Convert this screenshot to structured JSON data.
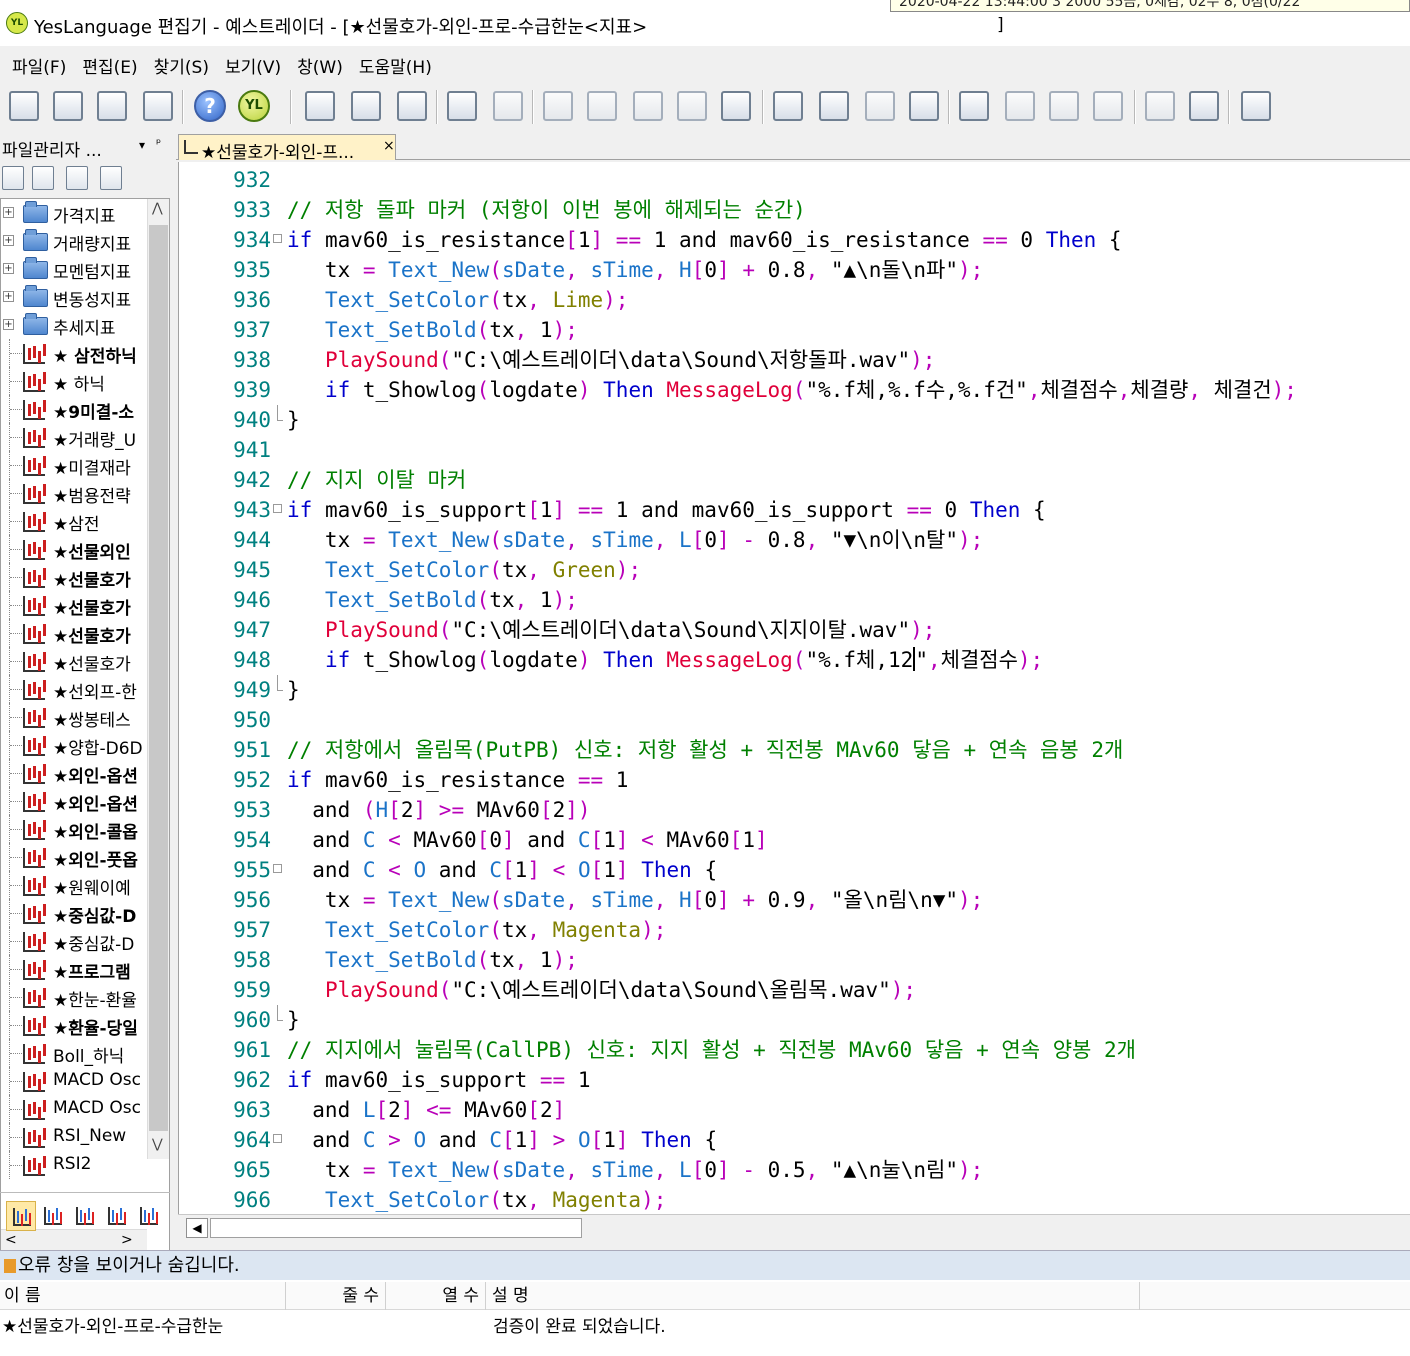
{
  "window": {
    "title": "YesLanguage 편집기 - 예스트레이더 - [★선물호가-외인-프로-수급한눈<지표>",
    "title_bracket": "]",
    "tooltip_fragment": "2020-04-22 13:44:00       3 2000  55금,  0체감,  02수 8,  0점(0/22"
  },
  "menu": {
    "items": [
      "파일(F)",
      "편집(E)",
      "찾기(S)",
      "보기(V)",
      "창(W)",
      "도움말(H)"
    ]
  },
  "toolbar": {
    "help_glyph": "?",
    "yl_glyph": "YL",
    "buttons": [
      "new-file",
      "open-file",
      "save-file",
      "print",
      "help",
      "yeslanguage",
      "verify",
      "compile",
      "build",
      "table",
      "table-alt",
      "cut",
      "copy",
      "paste",
      "grid",
      "grid-alt",
      "find",
      "find-next",
      "replace",
      "spell-check",
      "book-open",
      "book-prev",
      "book-next",
      "book-close",
      "comment",
      "uncomment",
      "settings"
    ]
  },
  "left_panel": {
    "title": "파일관리자 ...",
    "dropdown_glyph": "▾",
    "pin_glyph": "ᵖ",
    "folders": [
      "가격지표",
      "거래량지표",
      "모멘텀지표",
      "변동성지표",
      "추세지표"
    ],
    "files": [
      {
        "label": "★ 삼전하닉",
        "bold": true
      },
      {
        "label": "★ 하닉",
        "bold": false
      },
      {
        "label": "★9미결-소",
        "bold": true
      },
      {
        "label": "★거래량_U",
        "bold": false
      },
      {
        "label": "★미결재라",
        "bold": false
      },
      {
        "label": "★범용전략",
        "bold": false
      },
      {
        "label": "★삼전",
        "bold": false
      },
      {
        "label": "★선물외인",
        "bold": true
      },
      {
        "label": "★선물호가",
        "bold": true
      },
      {
        "label": "★선물호가",
        "bold": true
      },
      {
        "label": "★선물호가",
        "bold": true
      },
      {
        "label": "★선물호가",
        "bold": false
      },
      {
        "label": "★선외프-한",
        "bold": false
      },
      {
        "label": "★쌍봉테스",
        "bold": false
      },
      {
        "label": "★양합-D6D",
        "bold": false
      },
      {
        "label": "★외인-옵션",
        "bold": true
      },
      {
        "label": "★외인-옵션",
        "bold": true
      },
      {
        "label": "★외인-콜옵",
        "bold": true
      },
      {
        "label": "★외인-풋옵",
        "bold": true
      },
      {
        "label": "★원웨이예",
        "bold": false
      },
      {
        "label": "★중심값-D",
        "bold": true
      },
      {
        "label": "★중심값-D",
        "bold": false
      },
      {
        "label": "★프로그램",
        "bold": true
      },
      {
        "label": "★한눈-환율",
        "bold": false
      },
      {
        "label": "★환율-당일",
        "bold": true
      },
      {
        "label": "Boll_하닉",
        "bold": false
      },
      {
        "label": "MACD Osc",
        "bold": false
      },
      {
        "label": "MACD Osc",
        "bold": false
      },
      {
        "label": "RSI_New",
        "bold": false
      },
      {
        "label": "RSI2",
        "bold": false
      }
    ],
    "scroll_up": "⋀",
    "scroll_down": "⋁",
    "scroll_left": "<",
    "scroll_right": ">"
  },
  "editor": {
    "tab_label": "★선물호가-외인-프...",
    "tab_close": "×",
    "scroll_left": "◀"
  },
  "output": {
    "title": "오류 창을 보이거나 숨깁니다.",
    "columns": [
      "이 름",
      "줄 수",
      "열 수",
      "설 명"
    ],
    "rows": [
      {
        "name": "★선물호가-외인-프로-수급한눈",
        "line": "",
        "col": "",
        "desc": "검증이 완료 되었습니다."
      }
    ]
  },
  "code_lines": [
    {
      "n": "932",
      "fold": "",
      "html": ""
    },
    {
      "n": "933",
      "fold": "",
      "html": "<span class='cmt'>// 저항 돌파 마커 (저항이 이번 봉에 해제되는 순간)</span>"
    },
    {
      "n": "934",
      "fold": "box",
      "html": "<span class='kw'>if</span> mav60_is_resistance<span class='op'>[</span>1<span class='op'>]</span> <span class='op'>==</span> 1 and mav60_is_resistance <span class='op'>==</span> 0 <span class='kw'>Then</span> {"
    },
    {
      "n": "935",
      "fold": "",
      "html": "   tx <span class='op'>=</span> <span class='fn-cyan'>Text_New</span><span class='op'>(</span><span class='fn-cyan'>sDate</span><span class='op'>,</span> <span class='fn-cyan'>sTime</span><span class='op'>,</span> <span class='fn-cyan'>H</span><span class='op'>[</span>0<span class='op'>]</span> <span class='op'>+</span> 0.8<span class='op'>,</span> \"▲\\n돌\\n파\"<span class='op'>);</span>"
    },
    {
      "n": "936",
      "fold": "",
      "html": "   <span class='fn-cyan'>Text_SetColor</span><span class='op'>(</span>tx<span class='op'>,</span> <span class='olive'>Lime</span><span class='op'>);</span>"
    },
    {
      "n": "937",
      "fold": "",
      "html": "   <span class='fn-cyan'>Text_SetBold</span><span class='op'>(</span>tx<span class='op'>,</span> 1<span class='op'>);</span>"
    },
    {
      "n": "938",
      "fold": "",
      "html": "   <span class='fn-red'>PlaySound</span><span class='op'>(</span>\"C:\\예스트레이더\\data\\Sound\\저항돌파.wav\"<span class='op'>);</span>"
    },
    {
      "n": "939",
      "fold": "",
      "html": "   <span class='kw'>if</span> t_Showlog<span class='op'>(</span>logdate<span class='op'>)</span> <span class='kw'>Then</span> <span class='fn-red'>MessageLog</span><span class='op'>(</span>\"%.f체,%.f수,%.f건\"<span class='op'>,</span>체결점수<span class='op'>,</span>체결량<span class='op'>,</span> 체결건<span class='op'>);</span>"
    },
    {
      "n": "940",
      "fold": "end",
      "html": "}"
    },
    {
      "n": "941",
      "fold": "",
      "html": ""
    },
    {
      "n": "942",
      "fold": "",
      "html": "<span class='cmt'>// 지지 이탈 마커</span>"
    },
    {
      "n": "943",
      "fold": "box",
      "html": "<span class='kw'>if</span> mav60_is_support<span class='op'>[</span>1<span class='op'>]</span> <span class='op'>==</span> 1 and mav60_is_support <span class='op'>==</span> 0 <span class='kw'>Then</span> {"
    },
    {
      "n": "944",
      "fold": "",
      "html": "   tx <span class='op'>=</span> <span class='fn-cyan'>Text_New</span><span class='op'>(</span><span class='fn-cyan'>sDate</span><span class='op'>,</span> <span class='fn-cyan'>sTime</span><span class='op'>,</span> <span class='fn-cyan'>L</span><span class='op'>[</span>0<span class='op'>]</span> <span class='op'>-</span> 0.8<span class='op'>,</span> \"▼\\n이\\n탈\"<span class='op'>);</span>"
    },
    {
      "n": "945",
      "fold": "",
      "html": "   <span class='fn-cyan'>Text_SetColor</span><span class='op'>(</span>tx<span class='op'>,</span> <span class='olive'>Green</span><span class='op'>);</span>"
    },
    {
      "n": "946",
      "fold": "",
      "html": "   <span class='fn-cyan'>Text_SetBold</span><span class='op'>(</span>tx<span class='op'>,</span> 1<span class='op'>);</span>"
    },
    {
      "n": "947",
      "fold": "",
      "html": "   <span class='fn-red'>PlaySound</span><span class='op'>(</span>\"C:\\예스트레이더\\data\\Sound\\지지이탈.wav\"<span class='op'>);</span>"
    },
    {
      "n": "948",
      "fold": "",
      "html": "   <span class='kw'>if</span> t_Showlog<span class='op'>(</span>logdate<span class='op'>)</span> <span class='kw'>Then</span> <span class='fn-red'>MessageLog</span><span class='op'>(</span>\"%.f체,12<span class='caret'></span>\"<span class='op'>,</span>체결점수<span class='op'>);</span>"
    },
    {
      "n": "949",
      "fold": "end",
      "html": "}"
    },
    {
      "n": "950",
      "fold": "",
      "html": ""
    },
    {
      "n": "951",
      "fold": "",
      "html": "<span class='cmt'>// 저항에서 올림목(PutPB) 신호: 저항 활성 + 직전봉 MAv60 닿음 + 연속 음봉 2개</span>"
    },
    {
      "n": "952",
      "fold": "",
      "html": "<span class='kw'>if</span> mav60_is_resistance <span class='op'>==</span> 1"
    },
    {
      "n": "953",
      "fold": "",
      "html": "  and <span class='op'>(</span><span class='fn-cyan'>H</span><span class='op'>[</span>2<span class='op'>]</span> <span class='op'>&gt;=</span> MAv60<span class='op'>[</span>2<span class='op'>])</span>"
    },
    {
      "n": "954",
      "fold": "",
      "html": "  and <span class='fn-cyan'>C</span> <span class='op'>&lt;</span> MAv60<span class='op'>[</span>0<span class='op'>]</span> and <span class='fn-cyan'>C</span><span class='op'>[</span>1<span class='op'>]</span> <span class='op'>&lt;</span> MAv60<span class='op'>[</span>1<span class='op'>]</span>"
    },
    {
      "n": "955",
      "fold": "box",
      "html": "  and <span class='fn-cyan'>C</span> <span class='op'>&lt;</span> <span class='fn-cyan'>O</span> and <span class='fn-cyan'>C</span><span class='op'>[</span>1<span class='op'>]</span> <span class='op'>&lt;</span> <span class='fn-cyan'>O</span><span class='op'>[</span>1<span class='op'>]</span> <span class='kw'>Then</span> {"
    },
    {
      "n": "956",
      "fold": "",
      "html": "   tx <span class='op'>=</span> <span class='fn-cyan'>Text_New</span><span class='op'>(</span><span class='fn-cyan'>sDate</span><span class='op'>,</span> <span class='fn-cyan'>sTime</span><span class='op'>,</span> <span class='fn-cyan'>H</span><span class='op'>[</span>0<span class='op'>]</span> <span class='op'>+</span> 0.9<span class='op'>,</span> \"올\\n림\\n▼\"<span class='op'>);</span>"
    },
    {
      "n": "957",
      "fold": "",
      "html": "   <span class='fn-cyan'>Text_SetColor</span><span class='op'>(</span>tx<span class='op'>,</span> <span class='olive'>Magenta</span><span class='op'>);</span>"
    },
    {
      "n": "958",
      "fold": "",
      "html": "   <span class='fn-cyan'>Text_SetBold</span><span class='op'>(</span>tx<span class='op'>,</span> 1<span class='op'>);</span>"
    },
    {
      "n": "959",
      "fold": "",
      "html": "   <span class='fn-red'>PlaySound</span><span class='op'>(</span>\"C:\\예스트레이더\\data\\Sound\\올림목.wav\"<span class='op'>);</span>"
    },
    {
      "n": "960",
      "fold": "end",
      "html": "}"
    },
    {
      "n": "961",
      "fold": "",
      "html": "<span class='cmt'>// 지지에서 눌림목(CallPB) 신호: 지지 활성 + 직전봉 MAv60 닿음 + 연속 양봉 2개</span>"
    },
    {
      "n": "962",
      "fold": "",
      "html": "<span class='kw'>if</span> mav60_is_support <span class='op'>==</span> 1"
    },
    {
      "n": "963",
      "fold": "",
      "html": "  and <span class='fn-cyan'>L</span><span class='op'>[</span>2<span class='op'>]</span> <span class='op'>&lt;=</span> MAv60<span class='op'>[</span>2<span class='op'>]</span>"
    },
    {
      "n": "964",
      "fold": "box",
      "html": "  and <span class='fn-cyan'>C</span> <span class='op'>&gt;</span> <span class='fn-cyan'>O</span> and <span class='fn-cyan'>C</span><span class='op'>[</span>1<span class='op'>]</span> <span class='op'>&gt;</span> <span class='fn-cyan'>O</span><span class='op'>[</span>1<span class='op'>]</span> <span class='kw'>Then</span> {"
    },
    {
      "n": "965",
      "fold": "",
      "html": "   tx <span class='op'>=</span> <span class='fn-cyan'>Text_New</span><span class='op'>(</span><span class='fn-cyan'>sDate</span><span class='op'>,</span> <span class='fn-cyan'>sTime</span><span class='op'>,</span> <span class='fn-cyan'>L</span><span class='op'>[</span>0<span class='op'>]</span> <span class='op'>-</span> 0.5<span class='op'>,</span> \"▲\\n눌\\n림\"<span class='op'>);</span>"
    },
    {
      "n": "966",
      "fold": "",
      "html": "   <span class='fn-cyan'>Text_SetColor</span><span class='op'>(</span>tx<span class='op'>,</span> <span class='olive'>Magenta</span><span class='op'>);</span>"
    }
  ]
}
